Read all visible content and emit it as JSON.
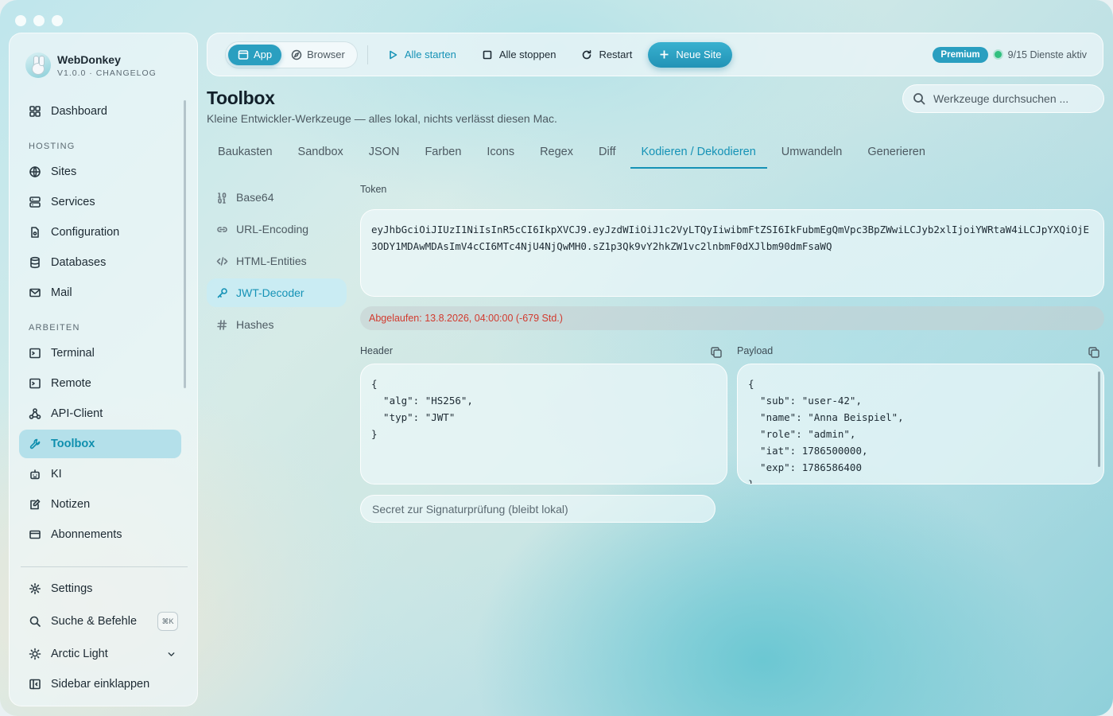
{
  "app": {
    "name": "WebDonkey",
    "version_line": "V1.0.0 · CHANGELOG"
  },
  "sidebar": {
    "top_items": [
      {
        "label": "Dashboard",
        "icon": "dashboard-icon"
      }
    ],
    "sections": [
      {
        "label": "HOSTING",
        "items": [
          {
            "label": "Sites",
            "icon": "globe-icon"
          },
          {
            "label": "Services",
            "icon": "server-icon"
          },
          {
            "label": "Configuration",
            "icon": "config-file-icon"
          },
          {
            "label": "Databases",
            "icon": "database-icon"
          },
          {
            "label": "Mail",
            "icon": "mail-icon"
          }
        ]
      },
      {
        "label": "ARBEITEN",
        "items": [
          {
            "label": "Terminal",
            "icon": "terminal-icon"
          },
          {
            "label": "Remote",
            "icon": "remote-terminal-icon"
          },
          {
            "label": "API-Client",
            "icon": "api-client-icon"
          },
          {
            "label": "Toolbox",
            "icon": "wrench-icon",
            "active": true
          },
          {
            "label": "KI",
            "icon": "robot-icon"
          },
          {
            "label": "Notizen",
            "icon": "notes-icon"
          },
          {
            "label": "Abonnements",
            "icon": "credit-card-icon"
          }
        ]
      }
    ],
    "bottom": {
      "settings": "Settings",
      "search": "Suche & Befehle",
      "search_shortcut": "⌘K",
      "theme": "Arctic Light",
      "collapse": "Sidebar einklappen"
    }
  },
  "toolbar": {
    "mode_app": "App",
    "mode_browser": "Browser",
    "start_all": "Alle starten",
    "stop_all": "Alle stoppen",
    "restart": "Restart",
    "new_site": "Neue Site",
    "premium": "Premium",
    "status": "9/15 Dienste aktiv",
    "status_color": "#31c07f"
  },
  "page": {
    "title": "Toolbox",
    "subtitle": "Kleine Entwickler-Werkzeuge — alles lokal, nichts verlässt diesen Mac.",
    "search_placeholder": "Werkzeuge durchsuchen ..."
  },
  "tabs": [
    "Baukasten",
    "Sandbox",
    "JSON",
    "Farben",
    "Icons",
    "Regex",
    "Diff",
    "Kodieren / Dekodieren",
    "Umwandeln",
    "Generieren"
  ],
  "active_tab": "Kodieren / Dekodieren",
  "subnav": [
    {
      "label": "Base64",
      "icon": "binary-icon"
    },
    {
      "label": "URL-Encoding",
      "icon": "link-icon"
    },
    {
      "label": "HTML-Entities",
      "icon": "code-icon"
    },
    {
      "label": "JWT-Decoder",
      "icon": "key-icon",
      "active": true
    },
    {
      "label": "Hashes",
      "icon": "hash-icon"
    }
  ],
  "jwt": {
    "token_label": "Token",
    "token": "eyJhbGciOiJIUzI1NiIsInR5cCI6IkpXVCJ9.eyJzdWIiOiJ1c2VyLTQyIiwibmFtZSI6IkFubmEgQmVpc3BpZWwiLCJyb2xlIjoiYWRtaW4iLCJpYXQiOjE3ODY1MDAwMDAsImV4cCI6MTc4NjU4NjQwMH0.sZ1p3Qk9vY2hkZW1vc2lnbmF0dXJlbm90dmFsaWQ",
    "expired_text": "Abgelaufen: 13.8.2026, 04:00:00 (-679 Std.)",
    "expired_color": "#d23a2f",
    "header_label": "Header",
    "header_json": "{\n  \"alg\": \"HS256\",\n  \"typ\": \"JWT\"\n}",
    "payload_label": "Payload",
    "payload_json": "{\n  \"sub\": \"user-42\",\n  \"name\": \"Anna Beispiel\",\n  \"role\": \"admin\",\n  \"iat\": 1786500000,\n  \"exp\": 1786586400\n}",
    "secret_placeholder": "Secret zur Signaturprüfung (bleibt lokal)"
  },
  "colors": {
    "accent": "#1592b6",
    "accent_button": "#2a9fc0"
  }
}
